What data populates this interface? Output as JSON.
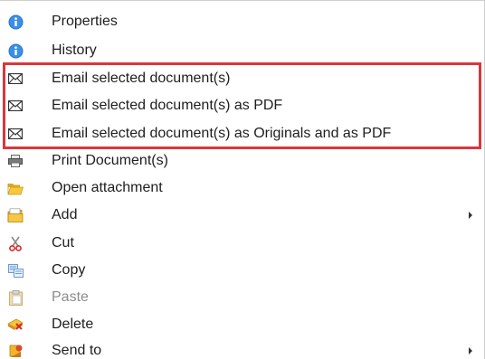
{
  "menu": {
    "items": [
      {
        "label": "Properties",
        "icon": "info-icon"
      },
      {
        "label": "History",
        "icon": "info-icon"
      },
      {
        "label": "Email selected document(s)",
        "icon": "envelope-icon"
      },
      {
        "label": "Email selected document(s) as PDF",
        "icon": "envelope-icon"
      },
      {
        "label": "Email selected document(s) as Originals and as PDF",
        "icon": "envelope-icon"
      },
      {
        "label": "Print Document(s)",
        "icon": "printer-icon"
      },
      {
        "label": "Open attachment",
        "icon": "folder-open-icon"
      },
      {
        "label": "Add",
        "icon": "folder-add-icon",
        "has_submenu": true
      },
      {
        "label": "Cut",
        "icon": "scissors-icon"
      },
      {
        "label": "Copy",
        "icon": "copy-icon"
      },
      {
        "label": "Paste",
        "icon": "paste-icon",
        "disabled": true
      },
      {
        "label": "Delete",
        "icon": "delete-icon"
      },
      {
        "label": "Send to",
        "icon": "send-to-icon",
        "has_submenu": true
      }
    ]
  },
  "colors": {
    "highlight_border": "#d9373d",
    "info_blue": "#1e73d2",
    "disabled_text": "#8c8c8c"
  }
}
